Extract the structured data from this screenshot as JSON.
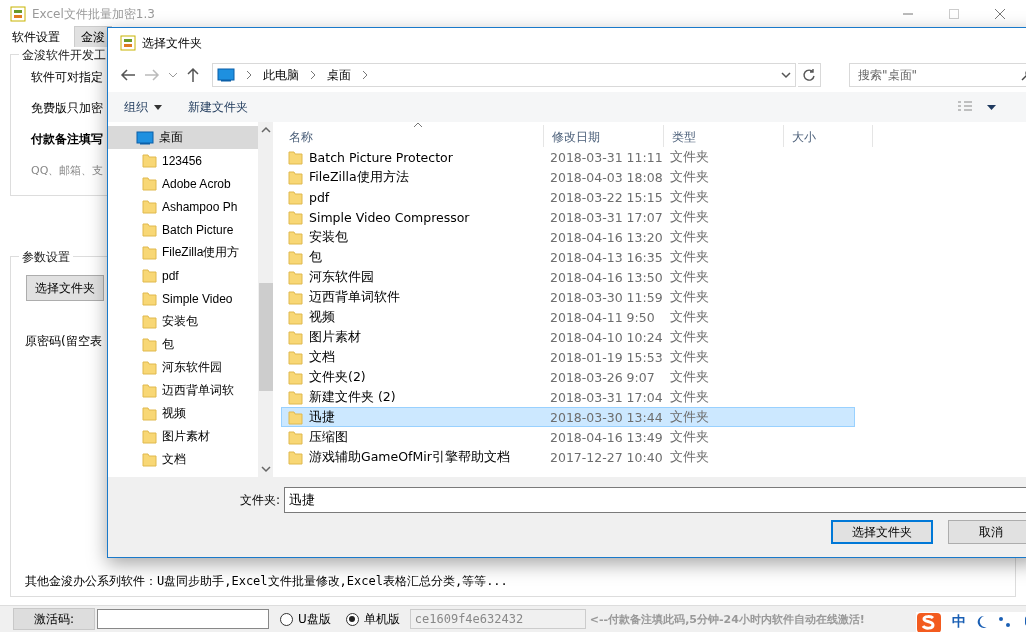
{
  "app_window": {
    "title": "Excel文件批量加密1.3",
    "tabs": [
      {
        "label": "软件设置",
        "selected": true
      },
      {
        "label": "金浚",
        "selected": false
      }
    ],
    "info_group": {
      "title": "金浚软件开发工",
      "lines": [
        {
          "text": "软件可对指定",
          "kind": "plain"
        },
        {
          "text": "免费版只加密",
          "kind": "plain"
        },
        {
          "text": "付款备注填写",
          "kind": "bold"
        },
        {
          "text": "QQ、邮箱、支",
          "kind": "hint"
        }
      ]
    },
    "params_group": {
      "title": "参数设置",
      "button": "选择文件夹",
      "password_label": "原密码(留空表"
    },
    "footer_text": "其他金浚办公系列软件：U盘同步助手,Excel文件批量修改,Excel表格汇总分类,等等...",
    "status_bar": {
      "activation_label": "激活码:",
      "radios": [
        {
          "label": "U盘版",
          "selected": false
        },
        {
          "label": "单机版",
          "selected": true
        }
      ],
      "code": "ce1609f4e632432",
      "note": "<--付款备注填此码,5分钟-24小时内软件自动在线激活!"
    }
  },
  "ime_bar": {
    "mode": "中"
  },
  "dialog": {
    "title": "选择文件夹",
    "breadcrumb": [
      "此电脑",
      "桌面"
    ],
    "search": {
      "placeholder": "搜索\"桌面\""
    },
    "toolbar": [
      {
        "label": "组织",
        "kind": "menu"
      },
      {
        "label": "新建文件夹",
        "kind": "button"
      }
    ],
    "nav_tree": [
      {
        "label": "桌面",
        "selected": true,
        "children": [
          {
            "label": "123456",
            "selected": false
          },
          {
            "label": "Adobe Acrob",
            "selected": false
          },
          {
            "label": "Ashampoo Ph",
            "selected": false
          },
          {
            "label": "Batch Picture",
            "selected": false
          },
          {
            "label": "FileZilla使用方",
            "selected": false
          },
          {
            "label": "pdf",
            "selected": false
          },
          {
            "label": "Simple Video",
            "selected": false
          },
          {
            "label": "安装包",
            "selected": false
          },
          {
            "label": "包",
            "selected": false
          },
          {
            "label": "河东软件园",
            "selected": false
          },
          {
            "label": "迈西背单词软",
            "selected": false
          },
          {
            "label": "视频",
            "selected": false
          },
          {
            "label": "图片素材",
            "selected": false
          },
          {
            "label": "文档",
            "selected": false
          }
        ]
      }
    ],
    "columns": [
      "名称",
      "修改日期",
      "类型",
      "大小"
    ],
    "rows": [
      {
        "name": "Batch Picture Protector",
        "modified": "2018-03-31 11:11",
        "type": "文件夹",
        "selected": false
      },
      {
        "name": "FileZilla使用方法",
        "modified": "2018-04-03 18:08",
        "type": "文件夹",
        "selected": false
      },
      {
        "name": "pdf",
        "modified": "2018-03-22 15:15",
        "type": "文件夹",
        "selected": false
      },
      {
        "name": "Simple Video Compressor",
        "modified": "2018-03-31 17:07",
        "type": "文件夹",
        "selected": false
      },
      {
        "name": "安装包",
        "modified": "2018-04-16 13:20",
        "type": "文件夹",
        "selected": false
      },
      {
        "name": "包",
        "modified": "2018-04-13 16:35",
        "type": "文件夹",
        "selected": false
      },
      {
        "name": "河东软件园",
        "modified": "2018-04-16 13:50",
        "type": "文件夹",
        "selected": false
      },
      {
        "name": "迈西背单词软件",
        "modified": "2018-03-30 11:59",
        "type": "文件夹",
        "selected": false
      },
      {
        "name": "视频",
        "modified": "2018-04-11 9:50",
        "type": "文件夹",
        "selected": false
      },
      {
        "name": "图片素材",
        "modified": "2018-04-10 10:24",
        "type": "文件夹",
        "selected": false
      },
      {
        "name": "文档",
        "modified": "2018-01-19 15:53",
        "type": "文件夹",
        "selected": false
      },
      {
        "name": "文件夹(2)",
        "modified": "2018-03-26 9:07",
        "type": "文件夹",
        "selected": false
      },
      {
        "name": "新建文件夹 (2)",
        "modified": "2018-03-31 17:04",
        "type": "文件夹",
        "selected": false
      },
      {
        "name": "迅捷",
        "modified": "2018-03-30 13:44",
        "type": "文件夹",
        "selected": true
      },
      {
        "name": "压缩图",
        "modified": "2018-04-16 13:49",
        "type": "文件夹",
        "selected": false
      },
      {
        "name": "游戏辅助GameOfMir引擎帮助文档",
        "modified": "2017-12-27 10:40",
        "type": "文件夹",
        "selected": false
      }
    ],
    "folder_label": "文件夹:",
    "folder_value": "迅捷",
    "buttons": [
      {
        "label": "选择文件夹",
        "kind": "default"
      },
      {
        "label": "取消",
        "kind": "normal"
      }
    ]
  }
}
